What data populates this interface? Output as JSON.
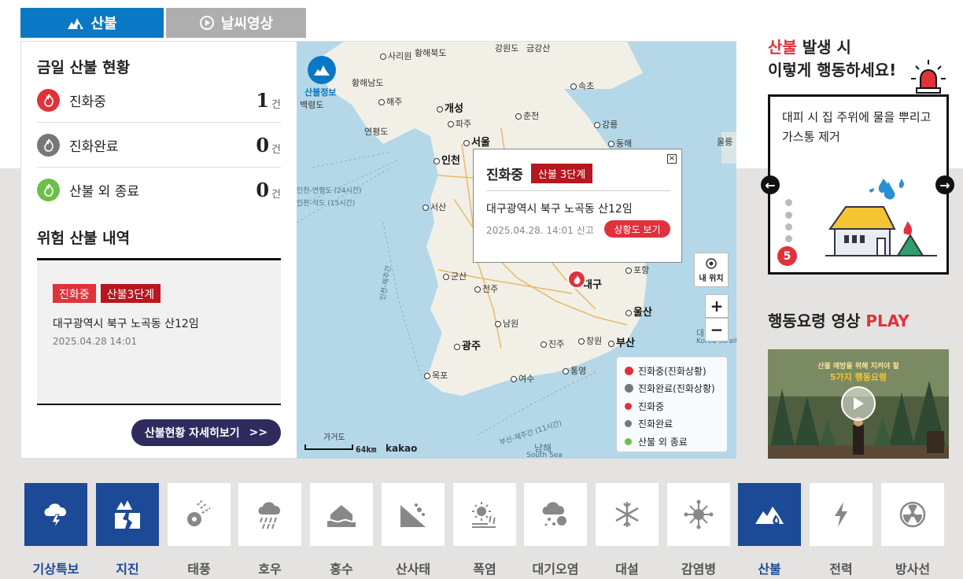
{
  "tabs": {
    "fire": "산불",
    "weather_video": "날씨영상"
  },
  "today": {
    "title": "금일 산불 현황",
    "rows": [
      {
        "label": "진화중",
        "count": "1",
        "unit": "건"
      },
      {
        "label": "진화완료",
        "count": "0",
        "unit": "건"
      },
      {
        "label": "산불 외 종료",
        "count": "0",
        "unit": "건"
      }
    ]
  },
  "risk": {
    "title": "위험 산불 내역",
    "badge_status": "진화중",
    "badge_level": "산불3단계",
    "location": "대구광역시 북구 노곡동 산12임",
    "datetime": "2025.04.28 14:01"
  },
  "detail_button": "산불현황 자세히보기",
  "map": {
    "logo_label": "산불정보",
    "popup": {
      "status": "진화중",
      "level": "산불 3단계",
      "location": "대구광역시 북구 노곡동 산12임",
      "reported": "2025.04.28. 14:01 신고",
      "button": "상황도 보기"
    },
    "my_location": "내 위치",
    "zoom_in": "+",
    "zoom_out": "−",
    "scale": "64km",
    "brand": "kakao",
    "legend": [
      {
        "label": "진화중(진화상황)",
        "color": "#e0323c"
      },
      {
        "label": "진화완료(진화상황)",
        "color": "#777777"
      },
      {
        "label": "진화중",
        "color": "#e0323c"
      },
      {
        "label": "진화완료",
        "color": "#777777"
      },
      {
        "label": "산불 외 종료",
        "color": "#6cbf4a"
      }
    ],
    "cities": [
      {
        "name": "사리원"
      },
      {
        "name": "황해북도"
      },
      {
        "name": "강원도"
      },
      {
        "name": "금강산"
      },
      {
        "name": "황해남도"
      },
      {
        "name": "해주"
      },
      {
        "name": "개성"
      },
      {
        "name": "속초"
      },
      {
        "name": "백령도"
      },
      {
        "name": "파주"
      },
      {
        "name": "춘천"
      },
      {
        "name": "강릉"
      },
      {
        "name": "연평도"
      },
      {
        "name": "서울"
      },
      {
        "name": "동해"
      },
      {
        "name": "울릉"
      },
      {
        "name": "인천"
      },
      {
        "name": "서산"
      },
      {
        "name": "군산"
      },
      {
        "name": "전주"
      },
      {
        "name": "대구"
      },
      {
        "name": "포항"
      },
      {
        "name": "울산"
      },
      {
        "name": "남원"
      },
      {
        "name": "광주"
      },
      {
        "name": "진주"
      },
      {
        "name": "창원"
      },
      {
        "name": "부산"
      },
      {
        "name": "목포"
      },
      {
        "name": "여수"
      },
      {
        "name": "통영"
      },
      {
        "name": "가거도"
      },
      {
        "name": "남해"
      },
      {
        "name": "South Sea"
      },
      {
        "name": "대한해협"
      },
      {
        "name": "Korea Strait"
      }
    ],
    "sea_routes": [
      "인천-연평도 (24시간)",
      "인천-석도 (15시간)",
      "인천-제주간",
      "부산-제주간 (11시간)"
    ]
  },
  "action": {
    "title_highlight": "산불",
    "title_rest": " 발생 시",
    "title_line2": "이렇게 행동하세요!",
    "tip": "대피 시 집 주위에 물을 뿌리고 가스통 제거",
    "step": "5",
    "video_title": "행동요령 영상",
    "video_play": "PLAY",
    "video_caption1": "산불 예방을 위해 지켜야 할",
    "video_caption2": "5가지 행동요령"
  },
  "menu": [
    {
      "label": "기상특보",
      "icon": "thunder-icon",
      "active": true
    },
    {
      "label": "지진",
      "icon": "earthquake-icon",
      "active": true
    },
    {
      "label": "태풍",
      "icon": "typhoon-icon",
      "active": false
    },
    {
      "label": "호우",
      "icon": "heavy-rain-icon",
      "active": false
    },
    {
      "label": "홍수",
      "icon": "flood-icon",
      "active": false
    },
    {
      "label": "산사태",
      "icon": "landslide-icon",
      "active": false
    },
    {
      "label": "폭염",
      "icon": "heatwave-icon",
      "active": false
    },
    {
      "label": "대기오염",
      "icon": "air-pollution-icon",
      "active": false
    },
    {
      "label": "대설",
      "icon": "snow-icon",
      "active": false
    },
    {
      "label": "감염병",
      "icon": "virus-icon",
      "active": false
    },
    {
      "label": "산불",
      "icon": "wildfire-icon",
      "active": true
    },
    {
      "label": "전력",
      "icon": "power-icon",
      "active": false
    },
    {
      "label": "방사선",
      "icon": "radiation-icon",
      "active": false
    }
  ]
}
